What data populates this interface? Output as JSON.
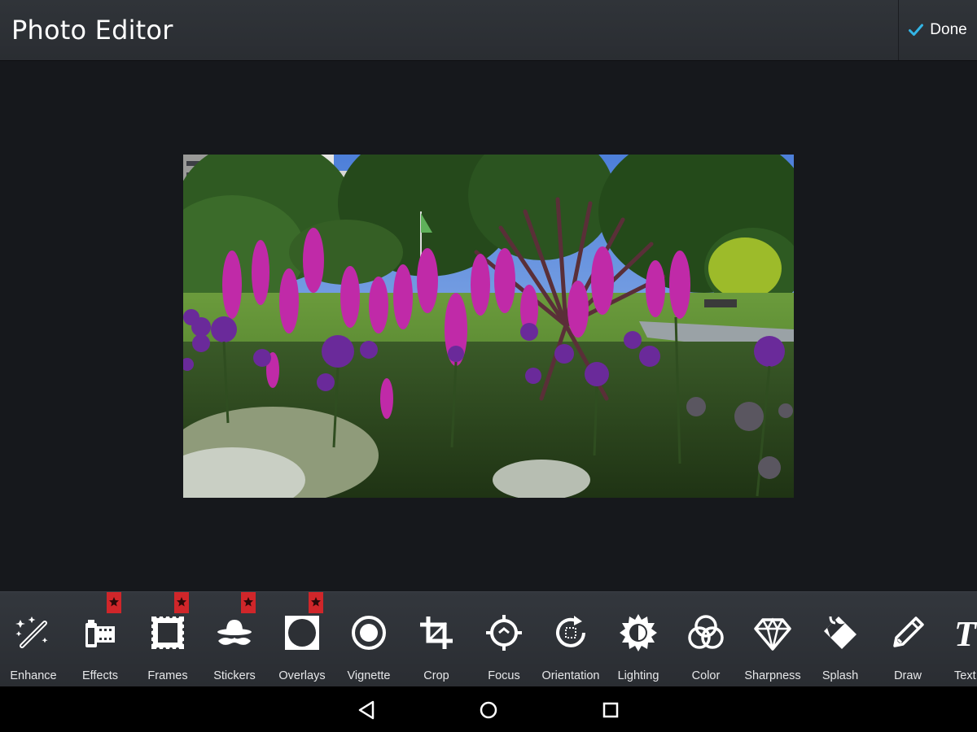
{
  "app": {
    "title": "Photo Editor",
    "done_label": "Done",
    "accent": "#33b5e5"
  },
  "tools": [
    {
      "label": "Enhance",
      "icon": "magic-wand-icon",
      "premium": false
    },
    {
      "label": "Effects",
      "icon": "film-icon",
      "premium": true
    },
    {
      "label": "Frames",
      "icon": "frame-icon",
      "premium": true
    },
    {
      "label": "Stickers",
      "icon": "hat-mustache-icon",
      "premium": true
    },
    {
      "label": "Overlays",
      "icon": "overlay-icon",
      "premium": true
    },
    {
      "label": "Vignette",
      "icon": "vignette-icon",
      "premium": false
    },
    {
      "label": "Crop",
      "icon": "crop-icon",
      "premium": false
    },
    {
      "label": "Focus",
      "icon": "focus-icon",
      "premium": false
    },
    {
      "label": "Orientation",
      "icon": "rotate-icon",
      "premium": false
    },
    {
      "label": "Lighting",
      "icon": "sun-icon",
      "premium": false
    },
    {
      "label": "Color",
      "icon": "color-circles-icon",
      "premium": false
    },
    {
      "label": "Sharpness",
      "icon": "diamond-icon",
      "premium": false
    },
    {
      "label": "Splash",
      "icon": "paint-bucket-icon",
      "premium": false
    },
    {
      "label": "Draw",
      "icon": "pencil-icon",
      "premium": false
    },
    {
      "label": "Text",
      "icon": "text-icon",
      "premium": false
    }
  ],
  "nav": {
    "back": "back-icon",
    "home": "home-icon",
    "recents": "recents-icon"
  }
}
